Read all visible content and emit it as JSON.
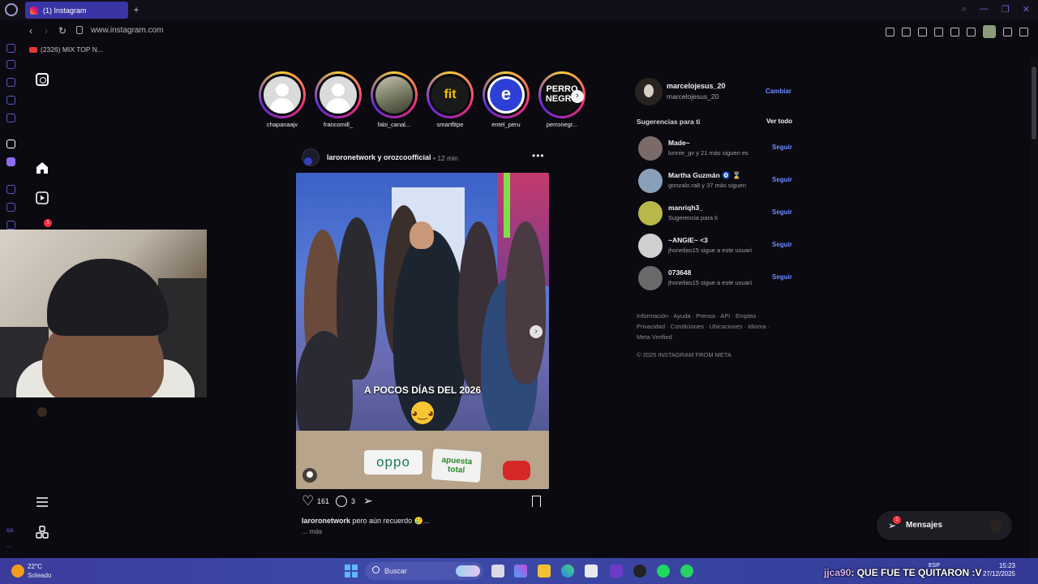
{
  "browser": {
    "tab_title": "(1) Instagram",
    "url": "www.instagram.com",
    "bookmark": "(2326) MIX TOP N..."
  },
  "stories": [
    {
      "name": "chapanaajv",
      "kind": "default"
    },
    {
      "name": "francomill_",
      "kind": "default"
    },
    {
      "name": "fabi_canal...",
      "kind": "photo"
    },
    {
      "name": "smartfitpe",
      "kind": "smartfit",
      "logo_text": "fit",
      "logo_small": "smart"
    },
    {
      "name": "entel_peru",
      "kind": "entel",
      "logo_text": "e"
    },
    {
      "name": "perronegr...",
      "kind": "perro",
      "logo_text": "PERRO NEGRO"
    }
  ],
  "post": {
    "author": "laroronetwork y orozcoofficial",
    "separator": "•",
    "time": "12 min",
    "image_caption": "A POCOS DÍAS DEL 2026",
    "brand_oppo": "oppo",
    "brand_apuesta": "apuesta total",
    "likes": "161",
    "comments": "3",
    "caption_user": "laroronetwork",
    "caption_text": "pero aún recuerdo 🥲...",
    "more": "... más"
  },
  "me": {
    "username": "marcelojesus_20",
    "name": "marcelojesus_20",
    "switch": "Cambiar"
  },
  "suggestions": {
    "title": "Sugerencias para ti",
    "see_all": "Ver todo",
    "follow": "Seguir",
    "items": [
      {
        "name": "Made~",
        "sub": "lunnie_gv y 21 más siguen es",
        "color": "#7a6a68"
      },
      {
        "name": "Martha Guzmán 🧿 ⌛",
        "sub": "gonzalo.ra8 y 37 más siguen",
        "color": "#8aa0b8"
      },
      {
        "name": "manriqh3_",
        "sub": "Sugerencia para ti",
        "color": "#b8b84a"
      },
      {
        "name": "~ANGIE~ <3",
        "sub": "jhonelias15 sigue a este usuari",
        "color": "#d0d0d0"
      },
      {
        "name": "073648",
        "sub": "jhonelias15 sigue a este usuari",
        "color": "#6a6a6a"
      }
    ]
  },
  "footer": {
    "links": "Información · Ayuda · Prensa · API · Empleo · Privacidad · Condiciones · Ubicaciones · Idioma · Meta Verified",
    "copyright": "© 2025 INSTAGRAM FROM META"
  },
  "messages": {
    "label": "Mensajes",
    "badge": "1"
  },
  "nav_badge": "1",
  "taskbar": {
    "temp": "22°C",
    "weather": "Soleado",
    "search": "Buscar",
    "lang": "ESP",
    "time": "15:23",
    "date": "27/12/2025"
  },
  "chat": {
    "user": "jjca90",
    "message": ": QUE FUE TE QUITARON :V"
  },
  "gx_label": "GX",
  "colors": {
    "accent": "#6e8dff",
    "tab_active": "#3a35a6",
    "badge": "#ff3040"
  }
}
